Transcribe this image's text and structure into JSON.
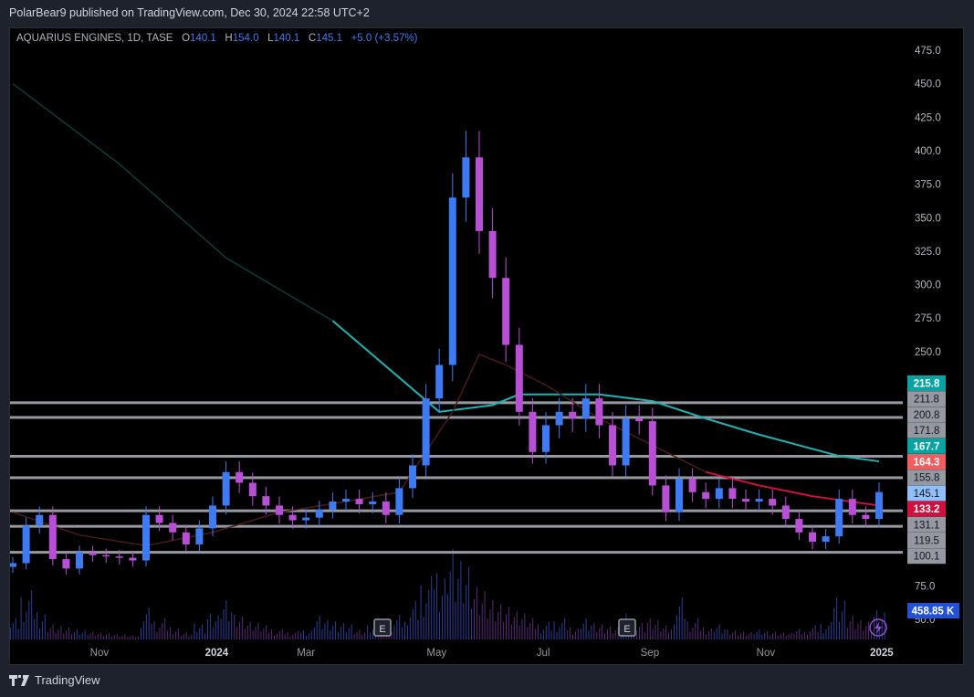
{
  "header": {
    "text": "PolarBear9 published on TradingView.com, Dec 30, 2024 22:58 UTC+2"
  },
  "legend": {
    "symbol": "AQUARIUS ENGINES, 1D, TASE",
    "o_label": "O",
    "o": "140.1",
    "h_label": "H",
    "h": "154.0",
    "l_label": "L",
    "l": "140.1",
    "c_label": "C",
    "c": "145.1",
    "change": "+5.0 (+3.57%)"
  },
  "footer": {
    "brand": "TradingView"
  },
  "colors": {
    "up": "#3d7bf5",
    "down": "#b94fd6",
    "ma_long": "#1bb3b3",
    "ma_short": "#d0103f",
    "hline": "#9598a1"
  },
  "chart_data": {
    "type": "candlestick",
    "title": "AQUARIUS ENGINES, 1D, TASE",
    "ylim": [
      50,
      475
    ],
    "y_ticks": [
      "475.0",
      "450.0",
      "425.0",
      "400.0",
      "375.0",
      "350.0",
      "325.0",
      "300.0",
      "275.0",
      "250.0",
      "75.0",
      "50.0"
    ],
    "y_tick_values": [
      475,
      450,
      425,
      400,
      375,
      350,
      325,
      300,
      275,
      250,
      75,
      50
    ],
    "x_ticks": [
      {
        "label": "Nov",
        "week": 6.5
      },
      {
        "label": "2024",
        "week": 15.3
      },
      {
        "label": "Mar",
        "week": 22
      },
      {
        "label": "May",
        "week": 31.8
      },
      {
        "label": "Jul",
        "week": 39.8
      },
      {
        "label": "Sep",
        "week": 47.8
      },
      {
        "label": "Nov",
        "week": 56.5
      },
      {
        "label": "2025",
        "week": 65.2
      }
    ],
    "weekly_close": [
      92,
      120,
      128,
      95,
      88,
      100,
      98,
      97,
      96,
      94,
      128,
      122,
      115,
      106,
      118,
      135,
      160,
      152,
      142,
      135,
      128,
      124,
      126,
      132,
      138,
      140,
      136,
      138,
      128,
      148,
      165,
      215,
      240,
      365,
      395,
      340,
      305,
      255,
      205,
      175,
      195,
      205,
      200,
      215,
      195,
      165,
      200,
      198,
      150,
      130,
      155,
      145,
      140,
      148,
      140,
      138,
      140,
      135,
      125,
      115,
      108,
      112,
      140,
      128,
      125,
      145.1
    ],
    "weekly_volume": [
      30,
      70,
      45,
      25,
      20,
      15,
      12,
      10,
      8,
      6,
      45,
      30,
      20,
      12,
      25,
      40,
      60,
      35,
      25,
      20,
      15,
      12,
      15,
      40,
      30,
      25,
      15,
      20,
      12,
      35,
      55,
      90,
      110,
      150,
      120,
      80,
      60,
      50,
      40,
      30,
      25,
      30,
      20,
      35,
      25,
      20,
      40,
      25,
      30,
      20,
      60,
      30,
      20,
      25,
      15,
      12,
      15,
      12,
      10,
      15,
      20,
      25,
      70,
      40,
      30,
      45
    ],
    "ma_long": {
      "weeks": [
        0,
        8,
        16,
        24,
        32,
        36,
        38,
        44,
        48,
        52,
        56,
        62,
        65
      ],
      "values": [
        450,
        390,
        320,
        273,
        205,
        210,
        218,
        218,
        213,
        200,
        188,
        172,
        168
      ]
    },
    "ma_short": {
      "weeks": [
        0,
        5,
        10,
        15,
        20,
        25,
        29,
        33,
        35,
        37,
        40,
        44,
        48,
        52,
        56,
        60,
        65
      ],
      "values": [
        130,
        113,
        105,
        115,
        130,
        138,
        145,
        205,
        248,
        240,
        225,
        200,
        180,
        160,
        150,
        142,
        135
      ]
    },
    "horizontal_levels": [
      211.8,
      200.8,
      171.8,
      155.8,
      131.1,
      119.5,
      100.1
    ],
    "price_labels": [
      {
        "text": "215.8",
        "bg": "#0aa3a3",
        "fg": "#ffffff"
      },
      {
        "text": "211.8",
        "bg": "#9598a1",
        "fg": "#131722"
      },
      {
        "text": "200.8",
        "bg": "#9598a1",
        "fg": "#131722"
      },
      {
        "text": "171.8",
        "bg": "#9598a1",
        "fg": "#131722"
      },
      {
        "text": "167.7",
        "bg": "#0aa3a3",
        "fg": "#ffffff"
      },
      {
        "text": "164.3",
        "bg": "#f25e5e",
        "fg": "#ffffff"
      },
      {
        "text": "155.8",
        "bg": "#9598a1",
        "fg": "#131722"
      },
      {
        "text": "145.1",
        "bg": "#90bff9",
        "fg": "#131722"
      },
      {
        "text": "133.2",
        "bg": "#d0103f",
        "fg": "#ffffff"
      },
      {
        "text": "131.1",
        "bg": "#9598a1",
        "fg": "#131722"
      },
      {
        "text": "119.5",
        "bg": "#9598a1",
        "fg": "#131722"
      },
      {
        "text": "100.1",
        "bg": "#9598a1",
        "fg": "#131722"
      }
    ],
    "volume_label": "458.85 K",
    "earnings_marker": "E"
  }
}
